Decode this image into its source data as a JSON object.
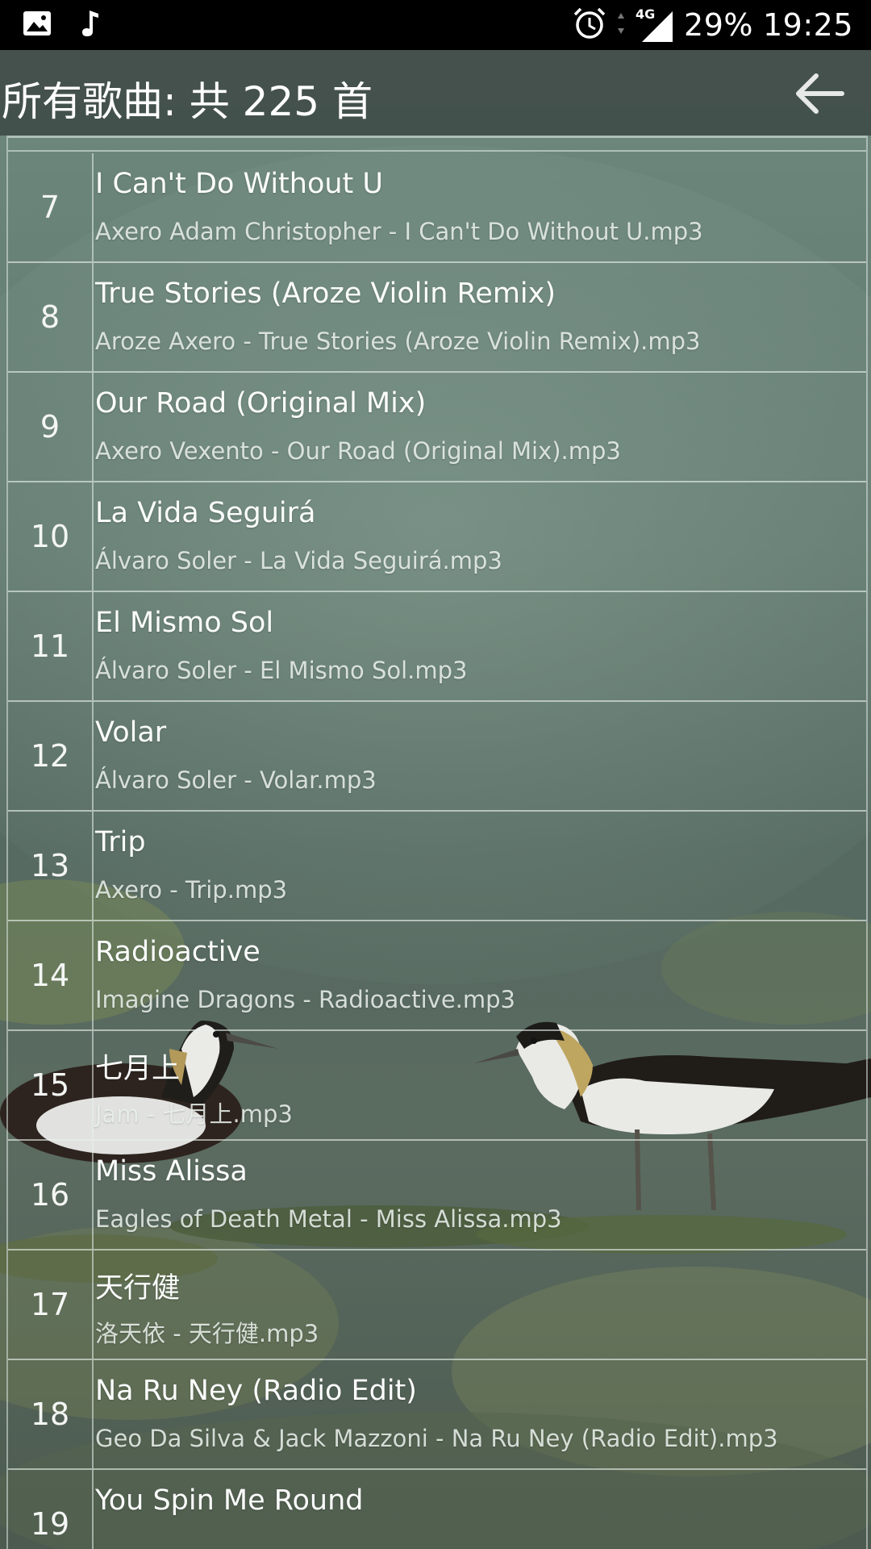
{
  "status_bar": {
    "left_icons": [
      "image-icon",
      "music-note-icon"
    ],
    "right_icons": [
      "alarm-icon",
      "data-arrows-icon",
      "signal-4g-icon"
    ],
    "network_label": "4G",
    "battery": "29%",
    "time": "19:25"
  },
  "header": {
    "title": "所有歌曲: 共 225 首",
    "back_icon": "back-arrow-icon"
  },
  "songs": [
    {
      "index": "7",
      "title": "I Can't Do Without U",
      "file": "Axero Adam Christopher - I Can't Do Without U.mp3"
    },
    {
      "index": "8",
      "title": "True Stories (Aroze Violin Remix)",
      "file": "Aroze Axero - True Stories (Aroze Violin Remix).mp3"
    },
    {
      "index": "9",
      "title": "Our Road (Original Mix)",
      "file": "Axero Vexento - Our Road (Original Mix).mp3"
    },
    {
      "index": "10",
      "title": "La Vida Seguirá",
      "file": "Álvaro Soler - La Vida Seguirá.mp3"
    },
    {
      "index": "11",
      "title": "El Mismo Sol",
      "file": "Álvaro Soler - El Mismo Sol.mp3"
    },
    {
      "index": "12",
      "title": "Volar",
      "file": "Álvaro Soler - Volar.mp3"
    },
    {
      "index": "13",
      "title": "Trip",
      "file": "Axero - Trip.mp3"
    },
    {
      "index": "14",
      "title": "Radioactive",
      "file": "Imagine Dragons - Radioactive.mp3"
    },
    {
      "index": "15",
      "title": "七月上",
      "file": "Jam - 七月上.mp3"
    },
    {
      "index": "16",
      "title": "Miss Alissa",
      "file": "Eagles of Death Metal - Miss Alissa.mp3"
    },
    {
      "index": "17",
      "title": "天行健",
      "file": "洛天依 - 天行健.mp3"
    },
    {
      "index": "18",
      "title": "Na Ru Ney (Radio Edit)",
      "file": "Geo Da Silva & Jack Mazzoni - Na Ru Ney (Radio Edit).mp3"
    },
    {
      "index": "19",
      "title": "You Spin Me Round",
      "file": ""
    }
  ],
  "colors": {
    "status_bar_bg": "#000000",
    "header_bg": "#3a4642",
    "divider": "#e8f0ec",
    "text_primary": "#ffffff"
  }
}
